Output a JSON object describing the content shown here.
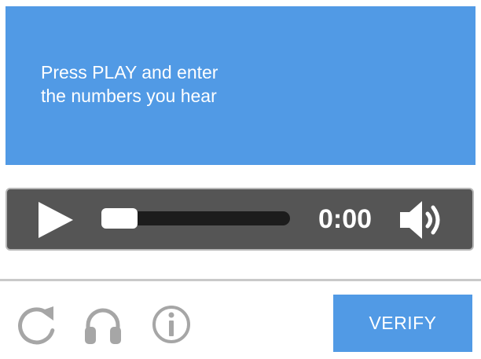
{
  "prompt": {
    "line1": "Press PLAY and enter",
    "line2": "the numbers you hear"
  },
  "player": {
    "time": "0:00",
    "progress": 0,
    "play_icon": "play-icon",
    "volume_icon": "volume-icon"
  },
  "toolbar": {
    "reload_icon": "reload-icon",
    "audio_icon": "headphones-icon",
    "help_icon": "info-icon",
    "verify_label": "VERIFY"
  },
  "colors": {
    "accent": "#519ae5",
    "player_bg": "#555555",
    "track": "#1c1c1c",
    "icon_gray": "#a6a6a6"
  }
}
